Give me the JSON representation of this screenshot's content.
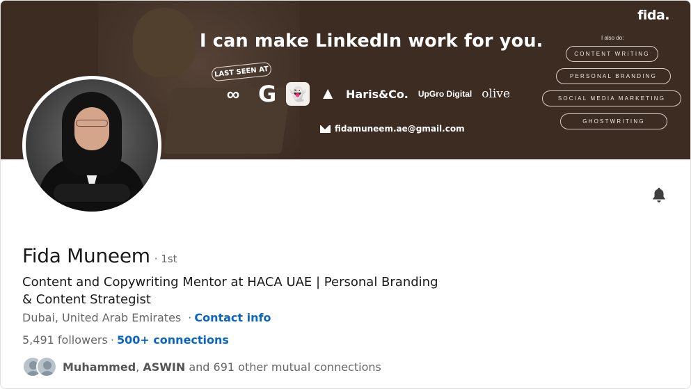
{
  "banner": {
    "brand": "fida.",
    "headline": "I can make LinkedIn work for you.",
    "also_label": "I also do:",
    "services": [
      "CONTENT WRITING",
      "PERSONAL BRANDING",
      "SOCIAL MEDIA MARKETING",
      "GHOSTWRITING"
    ],
    "last_seen_label": "LAST SEEN AT",
    "logos": {
      "logo1": "∞",
      "logo2": "G",
      "logo3": "👻",
      "logo4": "▲",
      "logo5": "Haris&Co.",
      "logo6": "UpGro Digital",
      "logo7": "olive"
    },
    "email": "fidamuneem.ae@gmail.com",
    "colors": {
      "background": "#3d2c22",
      "text": "#ffffff"
    }
  },
  "profile": {
    "name": "Fida Muneem",
    "degree": "· 1st",
    "headline": "Content and Copywriting Mentor at HACA UAE | Personal Branding & Content Strategist",
    "location": "Dubai, United Arab Emirates",
    "separator": "·",
    "contact_info": "Contact info",
    "followers": "5,491 followers",
    "connections": "500+ connections",
    "mutual": {
      "name1": "Muhammed",
      "sep": ",",
      "name2": "ASWIN",
      "rest": "and 691 other mutual connections"
    }
  },
  "icons": {
    "bell": "bell-icon",
    "mail": "mail-icon"
  },
  "colors": {
    "link": "#0a66c2",
    "muted": "#666666",
    "primary_text": "#191919"
  }
}
